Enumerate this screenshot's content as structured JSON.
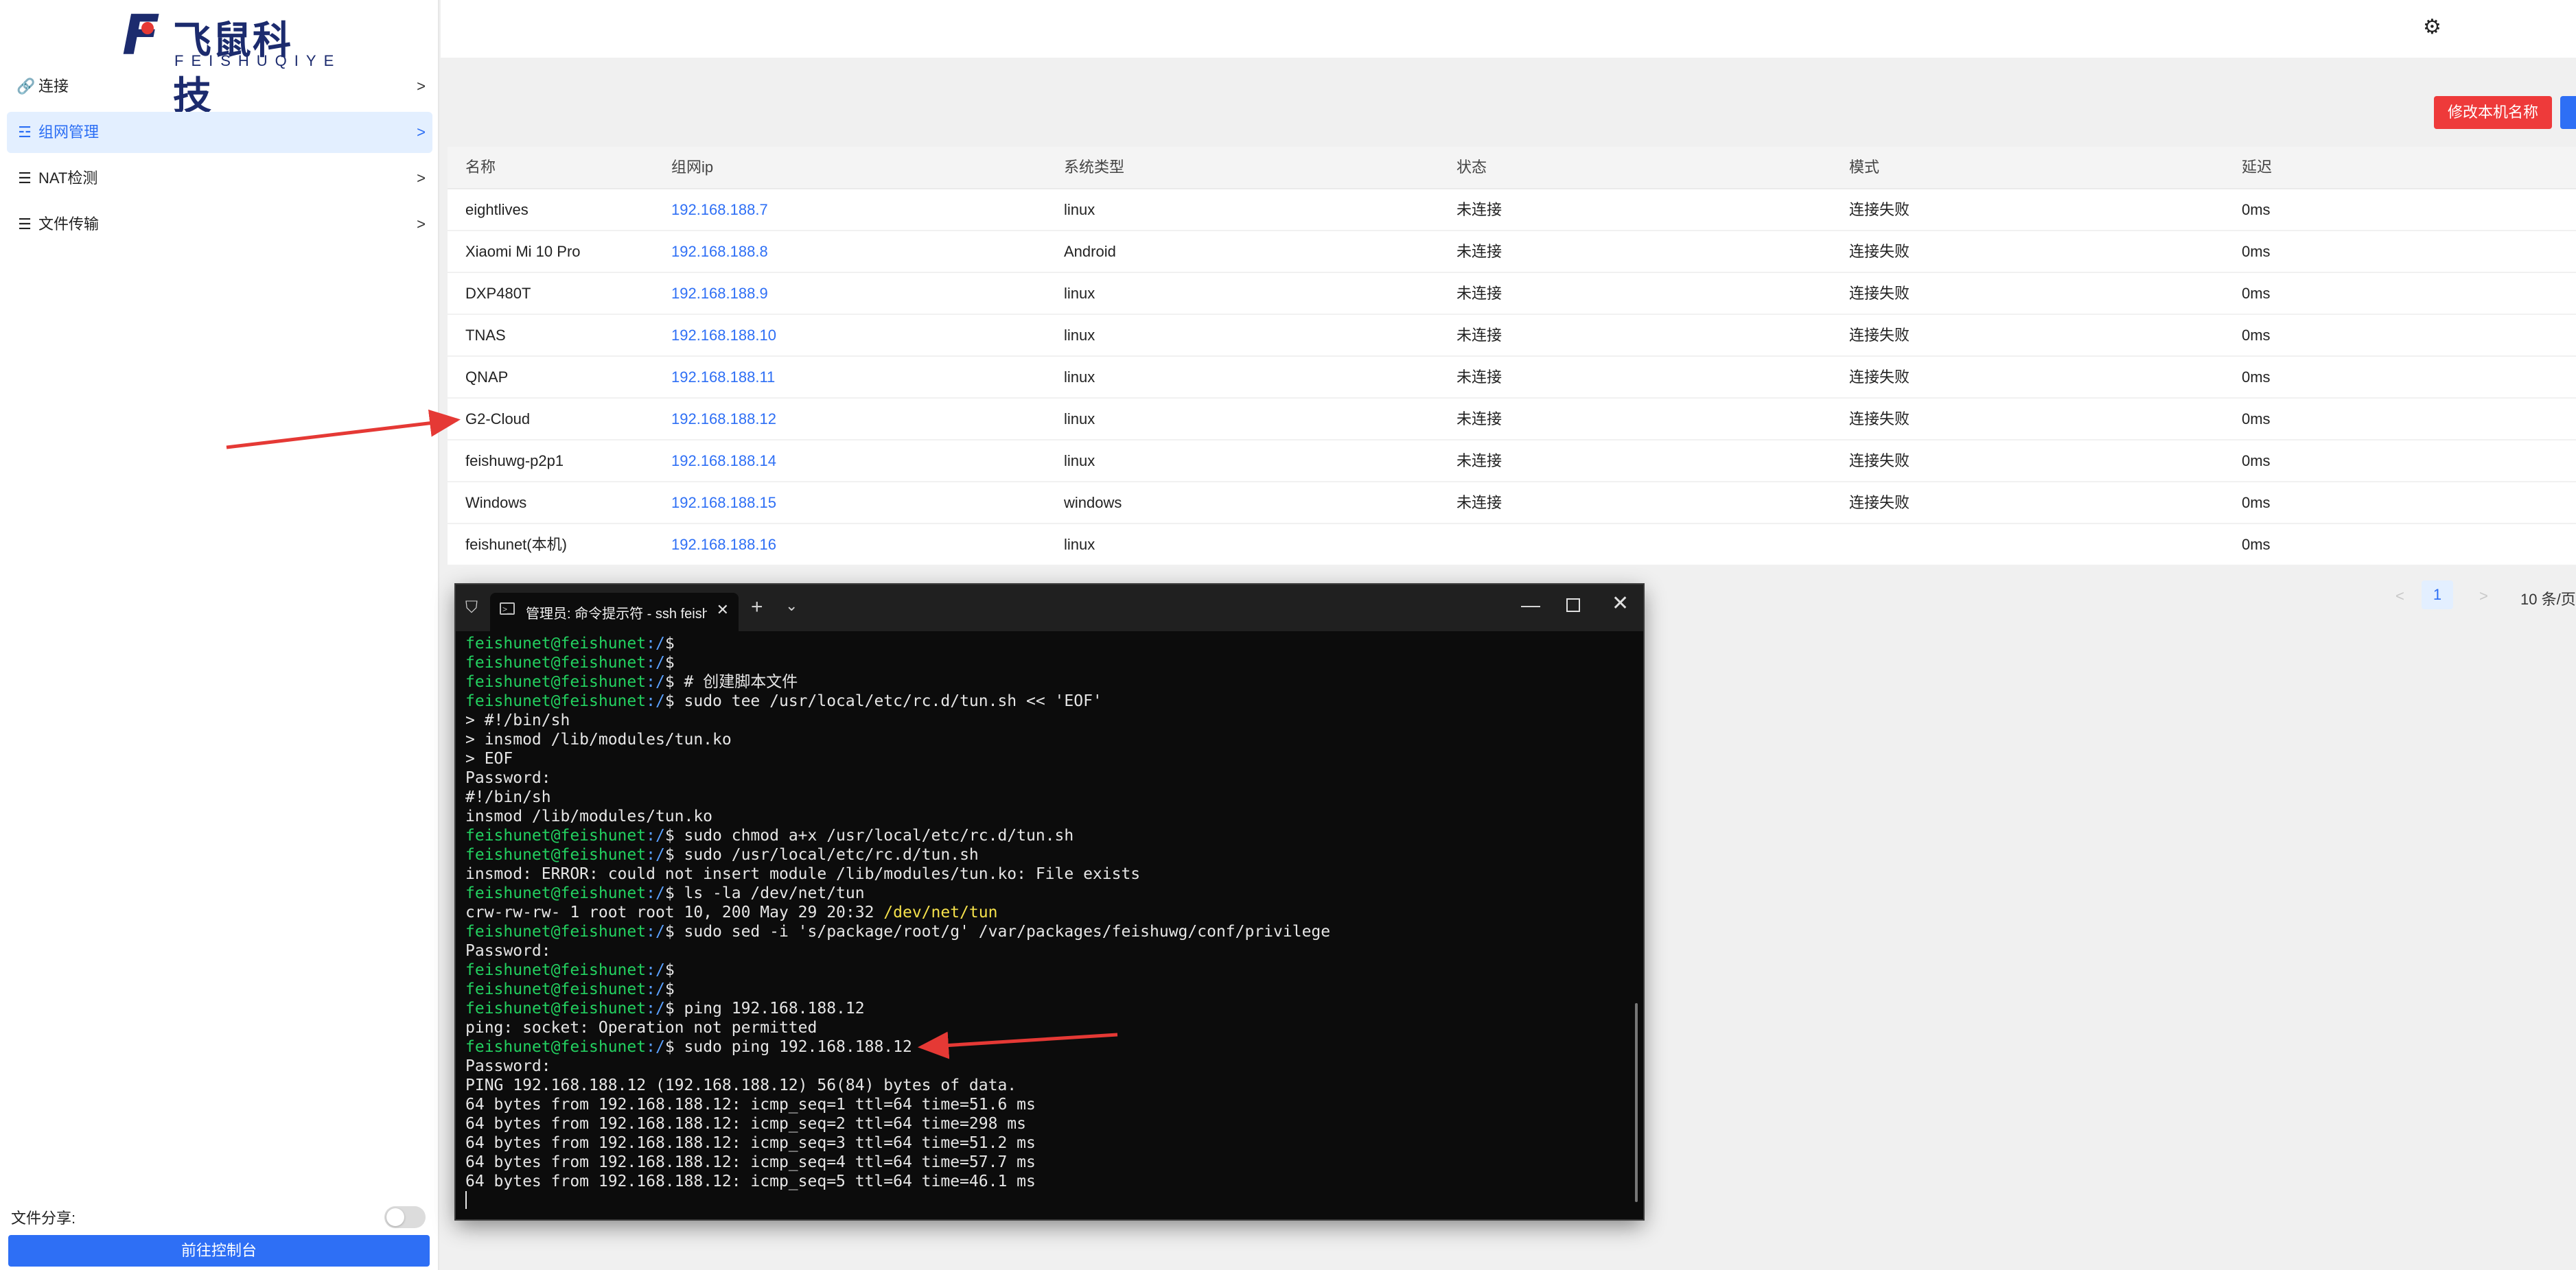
{
  "brand": {
    "cn": "飞鼠科技",
    "en": "FEISHUQIYE",
    "mark": "F"
  },
  "sidebar": {
    "items": [
      {
        "icon": "link-icon",
        "glyph": "🔗",
        "label": "连接",
        "chevron": ">"
      },
      {
        "icon": "network-icon",
        "glyph": "☲",
        "label": "组网管理",
        "chevron": ">",
        "active": true
      },
      {
        "icon": "list-icon",
        "glyph": "☰",
        "label": "NAT检测",
        "chevron": ">"
      },
      {
        "icon": "list-icon",
        "glyph": "☰",
        "label": "文件传输",
        "chevron": ">"
      }
    ],
    "file_share_label": "文件分享:",
    "console_button": "前往控制台"
  },
  "header": {
    "settings_icon": "gear-icon",
    "rename_button": "修改本机名称"
  },
  "table": {
    "columns": [
      "名称",
      "组网ip",
      "系统类型",
      "状态",
      "模式",
      "延迟"
    ],
    "rows": [
      {
        "name": "eightlives",
        "ip": "192.168.188.7",
        "os": "linux",
        "status": "未连接",
        "mode": "连接失败",
        "latency": "0ms"
      },
      {
        "name": "Xiaomi Mi 10 Pro",
        "ip": "192.168.188.8",
        "os": "Android",
        "status": "未连接",
        "mode": "连接失败",
        "latency": "0ms"
      },
      {
        "name": "DXP480T",
        "ip": "192.168.188.9",
        "os": "linux",
        "status": "未连接",
        "mode": "连接失败",
        "latency": "0ms"
      },
      {
        "name": "TNAS",
        "ip": "192.168.188.10",
        "os": "linux",
        "status": "未连接",
        "mode": "连接失败",
        "latency": "0ms"
      },
      {
        "name": "QNAP",
        "ip": "192.168.188.11",
        "os": "linux",
        "status": "未连接",
        "mode": "连接失败",
        "latency": "0ms"
      },
      {
        "name": "G2-Cloud",
        "ip": "192.168.188.12",
        "os": "linux",
        "status": "未连接",
        "mode": "连接失败",
        "latency": "0ms"
      },
      {
        "name": "feishuwg-p2p1",
        "ip": "192.168.188.14",
        "os": "linux",
        "status": "未连接",
        "mode": "连接失败",
        "latency": "0ms"
      },
      {
        "name": "Windows",
        "ip": "192.168.188.15",
        "os": "windows",
        "status": "未连接",
        "mode": "连接失败",
        "latency": "0ms"
      },
      {
        "name": "feishunet(本机)",
        "ip": "192.168.188.16",
        "os": "linux",
        "status": "",
        "mode": "",
        "latency": "0ms"
      }
    ]
  },
  "pagination": {
    "prev": "<",
    "current": "1",
    "next": ">",
    "page_size": "10 条/页"
  },
  "terminal": {
    "tab_title": "管理员: 命令提示符 - ssh  feish",
    "lines": [
      {
        "user": "feishunet@feishunet",
        "path": ":/",
        "cmd": "$"
      },
      {
        "user": "feishunet@feishunet",
        "path": ":/",
        "cmd": "$"
      },
      {
        "user": "feishunet@feishunet",
        "path": ":/",
        "cmd": "$ # 创建脚本文件"
      },
      {
        "user": "feishunet@feishunet",
        "path": ":/",
        "cmd": "$ sudo tee /usr/local/etc/rc.d/tun.sh << 'EOF'"
      },
      {
        "text": "> #!/bin/sh"
      },
      {
        "text": "> insmod /lib/modules/tun.ko"
      },
      {
        "text": "> EOF"
      },
      {
        "text": "Password:"
      },
      {
        "text": "#!/bin/sh"
      },
      {
        "text": "insmod /lib/modules/tun.ko"
      },
      {
        "user": "feishunet@feishunet",
        "path": ":/",
        "cmd": "$ sudo chmod a+x /usr/local/etc/rc.d/tun.sh"
      },
      {
        "user": "feishunet@feishunet",
        "path": ":/",
        "cmd": "$ sudo /usr/local/etc/rc.d/tun.sh"
      },
      {
        "text": "insmod: ERROR: could not insert module /lib/modules/tun.ko: File exists"
      },
      {
        "user": "feishunet@feishunet",
        "path": ":/",
        "cmd": "$ ls -la /dev/net/tun"
      },
      {
        "text": "crw-rw-rw- 1 root root 10, 200 May 29 20:32 ",
        "highlight": "/dev/net/tun"
      },
      {
        "user": "feishunet@feishunet",
        "path": ":/",
        "cmd": "$ sudo sed -i 's/package/root/g' /var/packages/feishuwg/conf/privilege"
      },
      {
        "text": "Password:"
      },
      {
        "user": "feishunet@feishunet",
        "path": ":/",
        "cmd": "$"
      },
      {
        "user": "feishunet@feishunet",
        "path": ":/",
        "cmd": "$"
      },
      {
        "user": "feishunet@feishunet",
        "path": ":/",
        "cmd": "$ ping 192.168.188.12"
      },
      {
        "text": "ping: socket: Operation not permitted"
      },
      {
        "user": "feishunet@feishunet",
        "path": ":/",
        "cmd": "$ sudo ping 192.168.188.12"
      },
      {
        "text": "Password:"
      },
      {
        "text": "PING 192.168.188.12 (192.168.188.12) 56(84) bytes of data."
      },
      {
        "text": "64 bytes from 192.168.188.12: icmp_seq=1 ttl=64 time=51.6 ms"
      },
      {
        "text": "64 bytes from 192.168.188.12: icmp_seq=2 ttl=64 time=298 ms"
      },
      {
        "text": "64 bytes from 192.168.188.12: icmp_seq=3 ttl=64 time=51.2 ms"
      },
      {
        "text": "64 bytes from 192.168.188.12: icmp_seq=4 ttl=64 time=57.7 ms"
      },
      {
        "text": "64 bytes from 192.168.188.12: icmp_seq=5 ttl=64 time=46.1 ms"
      }
    ]
  },
  "colors": {
    "accent": "#2e6ff5",
    "danger": "#ee3a3a",
    "annotation_arrow": "#e53935",
    "terminal_user": "#23d160",
    "terminal_path": "#5aa0ff",
    "terminal_highlight": "#f5e14b"
  }
}
